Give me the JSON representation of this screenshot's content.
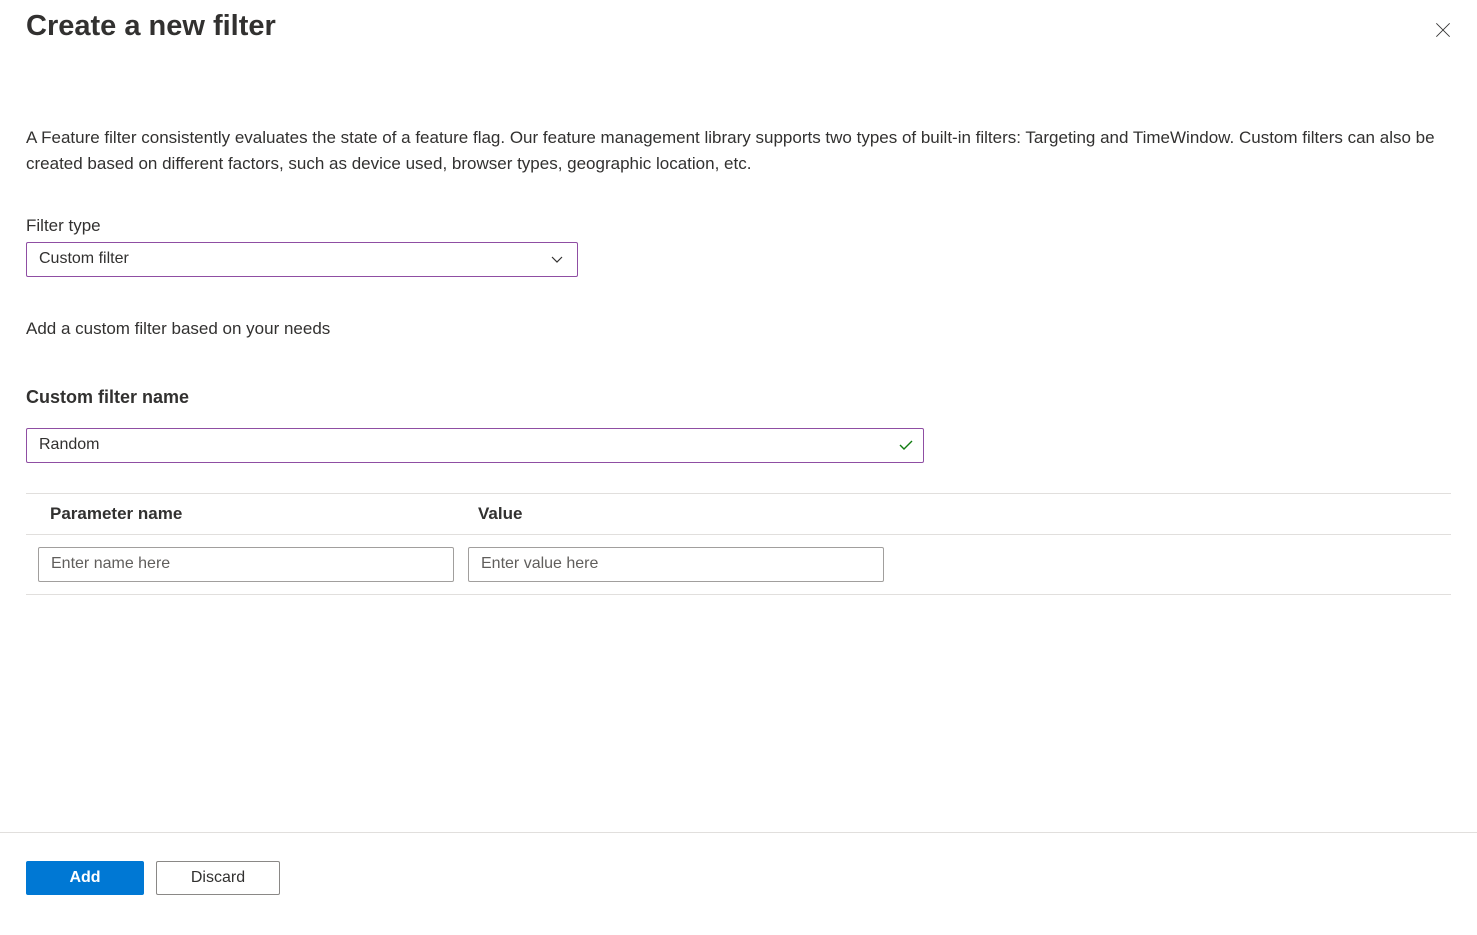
{
  "header": {
    "title": "Create a new filter"
  },
  "description": "A Feature filter consistently evaluates the state of a feature flag. Our feature management library supports two types of built-in filters: Targeting and TimeWindow. Custom filters can also be created based on different factors, such as device used, browser types, geographic location, etc.",
  "filterType": {
    "label": "Filter type",
    "selected": "Custom filter"
  },
  "helpText": "Add a custom filter based on your needs",
  "customFilterName": {
    "label": "Custom filter name",
    "value": "Random"
  },
  "paramsTable": {
    "headers": {
      "name": "Parameter name",
      "value": "Value"
    },
    "row": {
      "namePlaceholder": "Enter name here",
      "valuePlaceholder": "Enter value here",
      "nameValue": "",
      "valueValue": ""
    }
  },
  "footer": {
    "addLabel": "Add",
    "discardLabel": "Discard"
  }
}
